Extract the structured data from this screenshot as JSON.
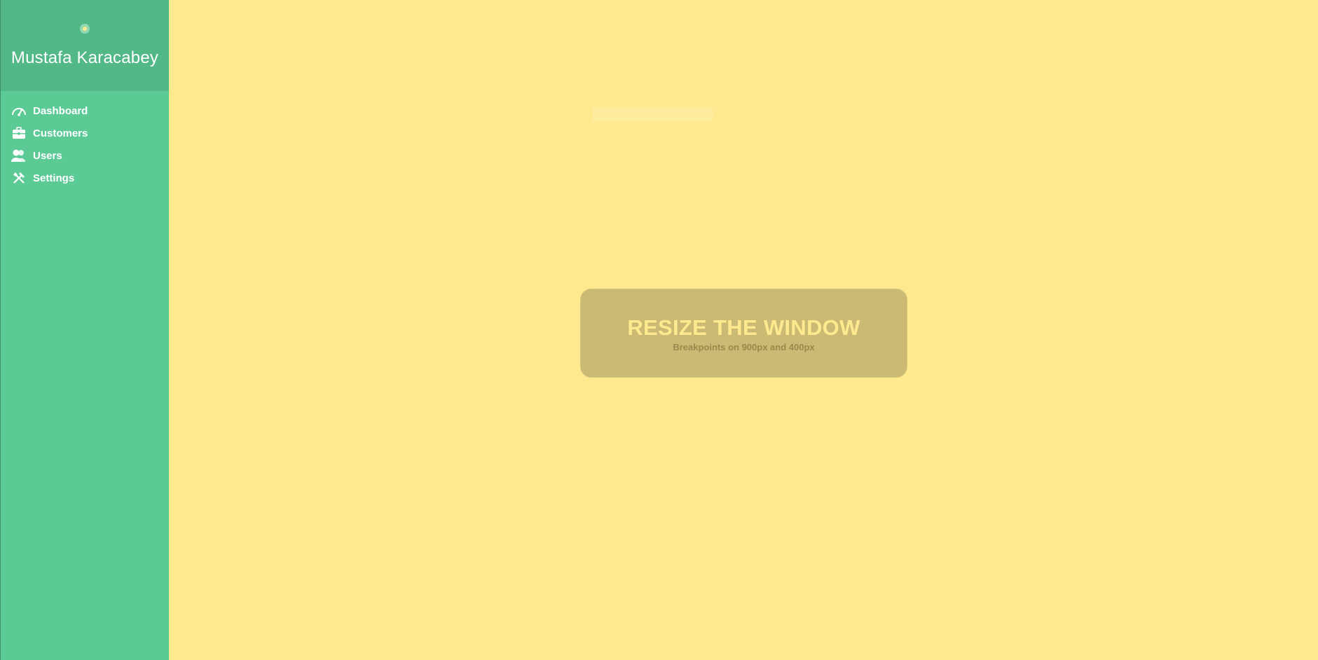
{
  "sidebar": {
    "user_name": "Mustafa Karacabey",
    "items": [
      {
        "label": "Dashboard",
        "icon": "dashboard-icon"
      },
      {
        "label": "Customers",
        "icon": "briefcase-icon"
      },
      {
        "label": "Users",
        "icon": "users-icon"
      },
      {
        "label": "Settings",
        "icon": "tools-icon"
      }
    ]
  },
  "notice": {
    "title": "RESIZE THE WINDOW",
    "subtitle": "Breakpoints on 900px and 400px"
  },
  "colors": {
    "background": "#ffe98f",
    "sidebar": "#5bca95",
    "sidebar_header": "#52b888",
    "notice_box": "#cbba73"
  }
}
